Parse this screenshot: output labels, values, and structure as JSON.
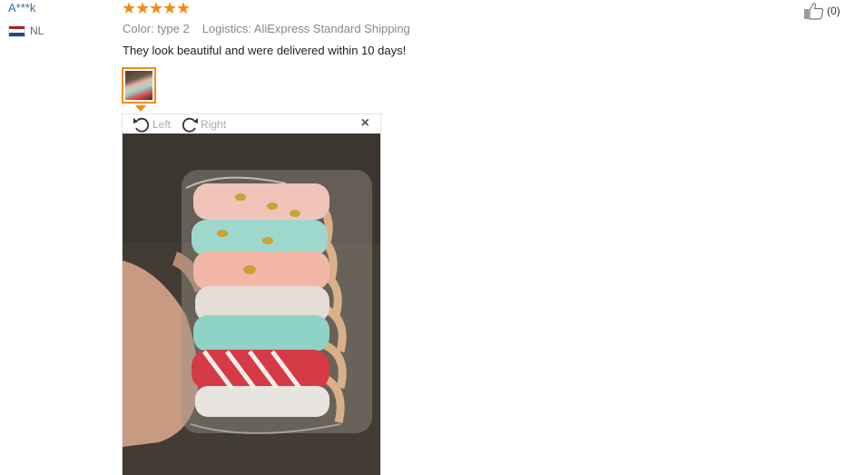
{
  "review": {
    "user_name": "A***k",
    "country_code": "NL",
    "rating": 5,
    "stars": [
      "★",
      "★",
      "★",
      "★",
      "★"
    ],
    "color_label": "Color: type 2",
    "logistics_label": "Logistics: AliExpress Standard Shipping",
    "text": "They look beautiful and were delivered within 10 days!",
    "like_count": "(0)"
  },
  "viewer": {
    "rotate_left_label": "Left",
    "rotate_right_label": "Right",
    "close_label": "×"
  },
  "colors": {
    "star": "#f08c14",
    "username": "#3a6ea5",
    "thumb_border": "#f08c14"
  },
  "icons": {
    "rotate_left": "rotate-left-icon",
    "rotate_right": "rotate-right-icon",
    "close": "close-icon",
    "like": "thumbs-up-icon",
    "flag": "netherlands-flag-icon"
  }
}
